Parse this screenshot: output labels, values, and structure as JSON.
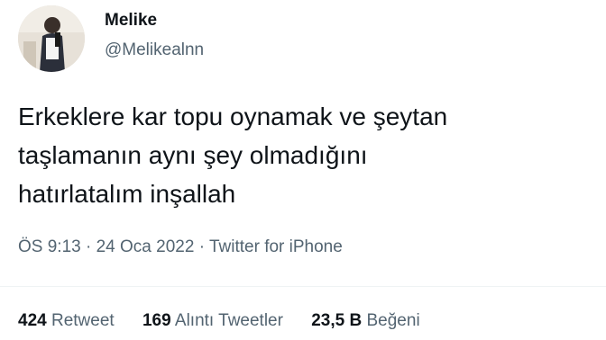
{
  "author": {
    "display_name": "Melike",
    "handle": "@Melikealnn"
  },
  "tweet": {
    "lines": [
      "Erkeklere kar topu oynamak ve şeytan",
      "taşlamanın aynı şey olmadığını",
      "hatırlatalım inşallah"
    ]
  },
  "meta": {
    "time": "ÖS 9:13",
    "separator": " · ",
    "date": "24 Oca 2022",
    "source": "Twitter for iPhone"
  },
  "stats": {
    "retweets_count": "424",
    "retweets_label": " Retweet",
    "quotes_count": "169",
    "quotes_label": " Alıntı Tweetler",
    "likes_count": "23,5 B",
    "likes_label": " Beğeni"
  }
}
